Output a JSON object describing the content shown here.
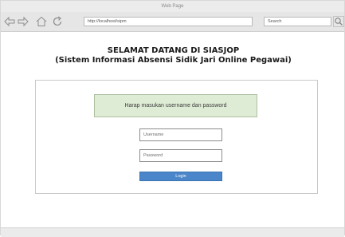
{
  "window": {
    "title": "Web Page"
  },
  "toolbar": {
    "icons": [
      "back-arrow-icon",
      "forward-arrow-icon",
      "home-icon",
      "reload-icon",
      "search-icon"
    ],
    "url": "http://localhost/sipm",
    "search_placeholder": "Search"
  },
  "page": {
    "title_line1": "SELAMAT DATANG DI SIASJOP",
    "title_line2": "(Sistem Informasi Absensi Sidik Jari Online Pegawai)",
    "info_message": "Harap masukan username dan password"
  },
  "form": {
    "username_placeholder": "Username",
    "password_placeholder": "Password",
    "login_label": "Login"
  },
  "colors": {
    "info_background": "#dfecd5",
    "login_button": "#4a86c9"
  }
}
